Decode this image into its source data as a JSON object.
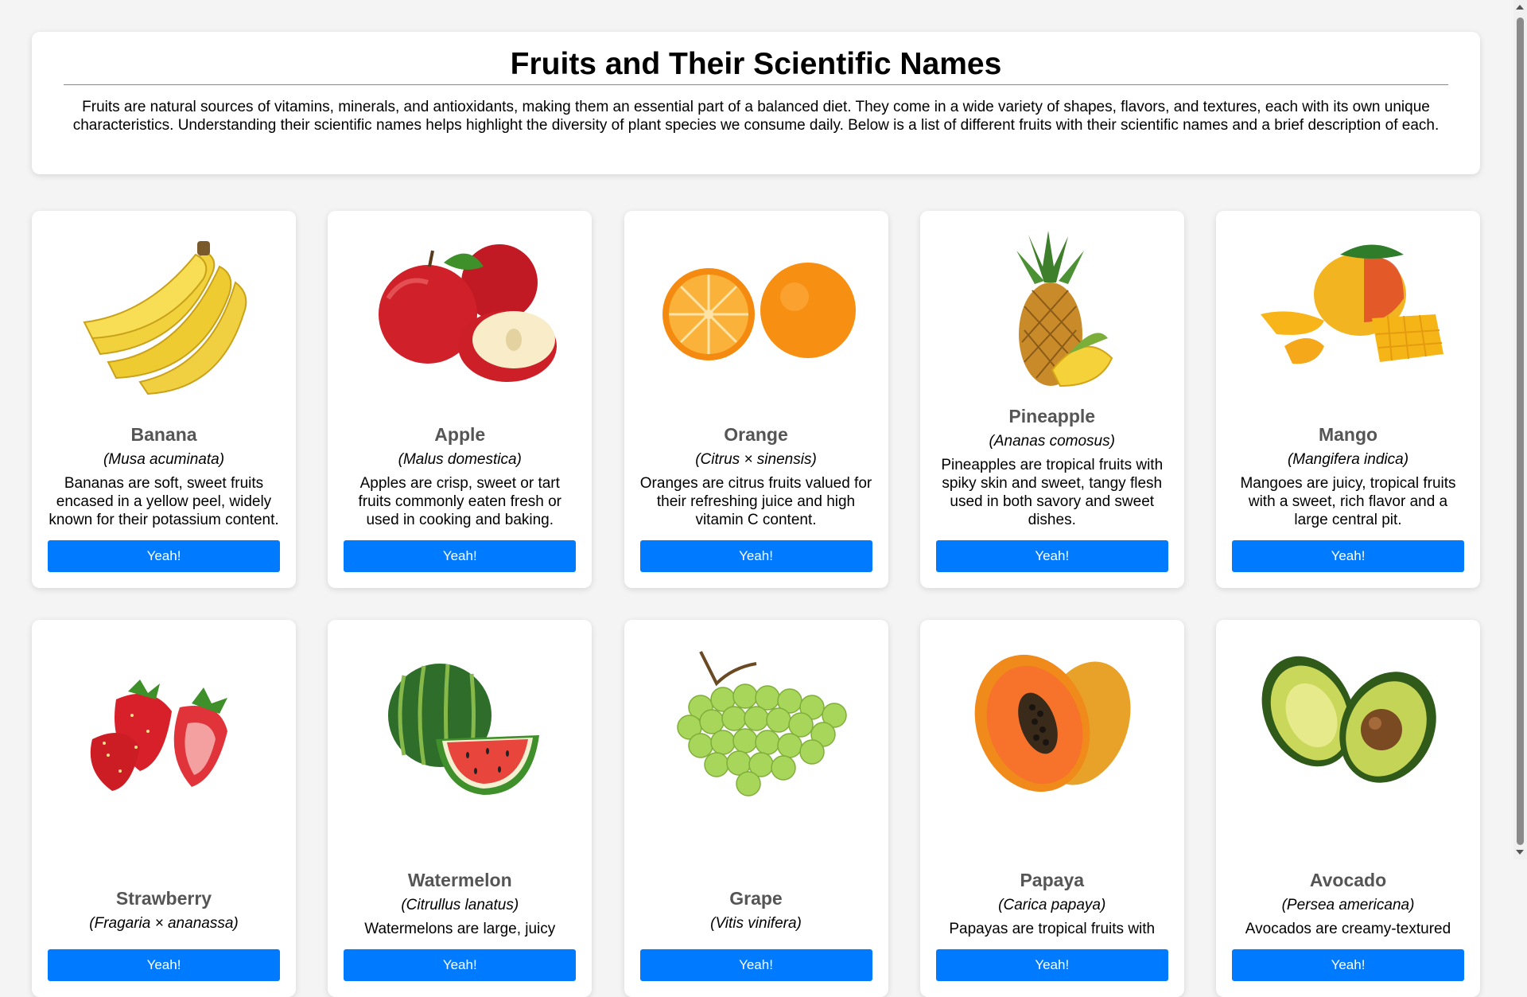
{
  "header": {
    "title": "Fruits and Their Scientific Names",
    "intro": "Fruits are natural sources of vitamins, minerals, and antioxidants, making them an essential part of a balanced diet. They come in a wide variety of shapes, flavors, and textures, each with its own unique characteristics. Understanding their scientific names helps highlight the diversity of plant species we consume daily. Below is a list of different fruits with their scientific names and a brief description of each."
  },
  "button_label": "Yeah!",
  "colors": {
    "button": "#007bff",
    "background": "#f4f4f4",
    "card": "#ffffff",
    "fruit_name": "#555555"
  },
  "fruits": [
    {
      "name": "Banana",
      "scientific": "(Musa acuminata)",
      "description": "Bananas are soft, sweet fruits encased in a yellow peel, widely known for their potassium content.",
      "icon": "banana-image"
    },
    {
      "name": "Apple",
      "scientific": "(Malus domestica)",
      "description": "Apples are crisp, sweet or tart fruits commonly eaten fresh or used in cooking and baking.",
      "icon": "apple-image"
    },
    {
      "name": "Orange",
      "scientific": "(Citrus × sinensis)",
      "description": "Oranges are citrus fruits valued for their refreshing juice and high vitamin C content.",
      "icon": "orange-image"
    },
    {
      "name": "Pineapple",
      "scientific": "(Ananas comosus)",
      "description": "Pineapples are tropical fruits with spiky skin and sweet, tangy flesh used in both savory and sweet dishes.",
      "icon": "pineapple-image"
    },
    {
      "name": "Mango",
      "scientific": "(Mangifera indica)",
      "description": "Mangoes are juicy, tropical fruits with a sweet, rich flavor and a large central pit.",
      "icon": "mango-image"
    },
    {
      "name": "Strawberry",
      "scientific": "(Fragaria × ananassa)",
      "description": "",
      "icon": "strawberry-image"
    },
    {
      "name": "Watermelon",
      "scientific": "(Citrullus lanatus)",
      "description": "Watermelons are large, juicy",
      "icon": "watermelon-image"
    },
    {
      "name": "Grape",
      "scientific": "(Vitis vinifera)",
      "description": "",
      "icon": "grape-image"
    },
    {
      "name": "Papaya",
      "scientific": "(Carica papaya)",
      "description": "Papayas are tropical fruits with",
      "icon": "papaya-image"
    },
    {
      "name": "Avocado",
      "scientific": "(Persea americana)",
      "description": "Avocados are creamy-textured",
      "icon": "avocado-image"
    }
  ]
}
